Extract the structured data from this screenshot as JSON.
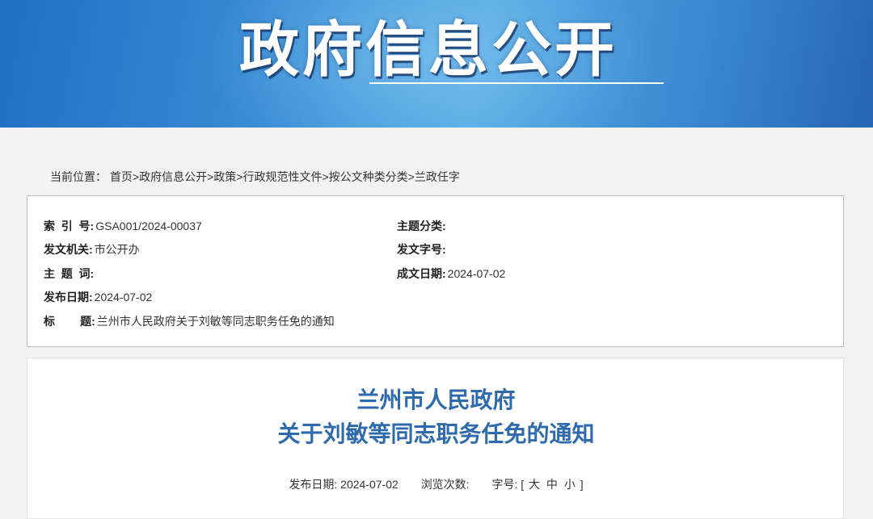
{
  "banner": {
    "title": "政府信息公开"
  },
  "breadcrumb": {
    "prefix": "当前位置：",
    "items": [
      "首页",
      "政府信息公开",
      "政策",
      "行政规范性文件",
      "按公文种类分类",
      "兰政任字"
    ],
    "separator": ">"
  },
  "meta": {
    "index_no": {
      "label": "索  引  号:",
      "value": "GSA001/2024-00037"
    },
    "topic_category": {
      "label": "主题分类:",
      "value": ""
    },
    "issuing_org": {
      "label": "发文机关:",
      "value": "市公开办"
    },
    "doc_number": {
      "label": "发文字号:",
      "value": ""
    },
    "keywords": {
      "label": "主  题  词:",
      "value": ""
    },
    "written_date": {
      "label": "成文日期:",
      "value": "2024-07-02"
    },
    "publish_date": {
      "label": "发布日期:",
      "value": "2024-07-02"
    },
    "title": {
      "label": "标        题:",
      "value": "兰州市人民政府关于刘敏等同志职务任免的通知"
    }
  },
  "document": {
    "title_line1": "兰州市人民政府",
    "title_line2": "关于刘敏等同志职务任免的通知",
    "publish_label": "发布日期:",
    "publish_value": "2024-07-02",
    "views_label": "浏览次数:",
    "views_value": "",
    "font_size_label": "字号:",
    "bracket_open": "[",
    "size_large": "大",
    "size_medium": "中",
    "size_small": "小",
    "bracket_close": "]"
  }
}
